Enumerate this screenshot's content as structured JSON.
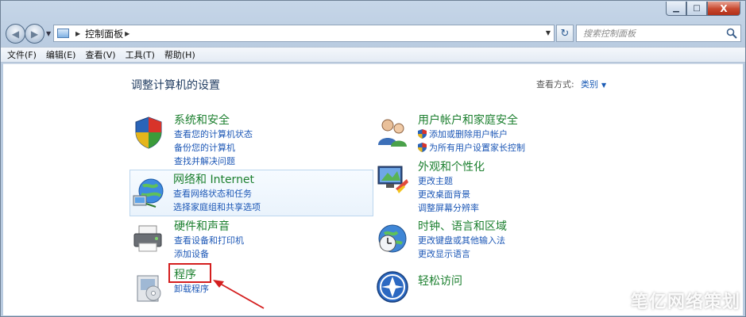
{
  "window": {
    "caption": {
      "minimize": "▁",
      "maximize": "□",
      "close": "X"
    }
  },
  "nav": {
    "breadcrumb": "控制面板",
    "search_placeholder": "搜索控制面板"
  },
  "menu": [
    "文件(F)",
    "编辑(E)",
    "查看(V)",
    "工具(T)",
    "帮助(H)"
  ],
  "content": {
    "title": "调整计算机的设置",
    "view_by_label": "查看方式:",
    "view_by_value": "类别",
    "categories": [
      {
        "title": "系统和安全",
        "links": [
          "查看您的计算机状态",
          "备份您的计算机",
          "查找并解决问题"
        ],
        "icon": "shield-icon"
      },
      {
        "title": "网络和 Internet",
        "links": [
          "查看网络状态和任务",
          "选择家庭组和共享选项"
        ],
        "icon": "network-globe-icon"
      },
      {
        "title": "硬件和声音",
        "links": [
          "查看设备和打印机",
          "添加设备"
        ],
        "icon": "printer-icon"
      },
      {
        "title": "程序",
        "links": [
          "卸载程序"
        ],
        "icon": "programs-icon"
      },
      {
        "title": "用户帐户和家庭安全",
        "links": [
          "添加或删除用户帐户",
          "为所有用户设置家长控制"
        ],
        "icon": "users-icon"
      },
      {
        "title": "外观和个性化",
        "links": [
          "更改主题",
          "更改桌面背景",
          "调整屏幕分辨率"
        ],
        "icon": "monitor-icon"
      },
      {
        "title": "时钟、语言和区域",
        "links": [
          "更改键盘或其他输入法",
          "更改显示语言"
        ],
        "icon": "clock-globe-icon"
      },
      {
        "title": "轻松访问",
        "links": [],
        "icon": "ease-of-access-icon"
      }
    ]
  },
  "watermark": "笔亿网络策划",
  "colors": {
    "category_title": "#1b7f2e",
    "link": "#1c57b6",
    "highlight_box": "#d41e1e"
  }
}
